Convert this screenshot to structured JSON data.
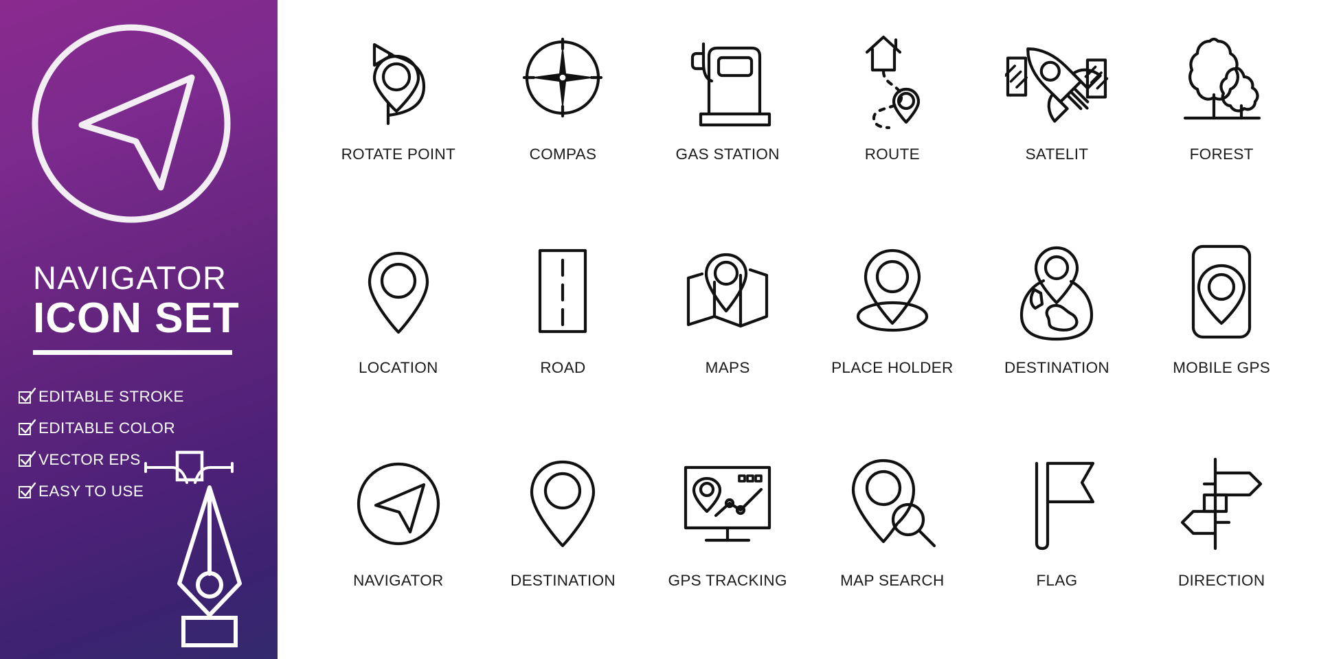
{
  "brand": {
    "logo_icon": "navigator-arrow-in-circle-icon",
    "title_line1": "NAVIGATOR",
    "title_line2": "ICON SET"
  },
  "features": [
    {
      "icon": "checkbox-checked-icon",
      "label": "EDITABLE STROKE"
    },
    {
      "icon": "checkbox-checked-icon",
      "label": "EDITABLE COLOR"
    },
    {
      "icon": "checkbox-checked-icon",
      "label": "VECTOR EPS"
    },
    {
      "icon": "checkbox-checked-icon",
      "label": "EASY TO USE"
    }
  ],
  "decorations": [
    {
      "icon": "bezier-node-handle-icon"
    },
    {
      "icon": "pen-nib-tool-icon"
    }
  ],
  "icons": [
    {
      "icon": "rotate-point-icon",
      "label": "ROTATE  POINT"
    },
    {
      "icon": "compass-icon",
      "label": "COMPAS"
    },
    {
      "icon": "gas-station-icon",
      "label": "GAS STATION"
    },
    {
      "icon": "route-icon",
      "label": "ROUTE"
    },
    {
      "icon": "satellite-icon",
      "label": "SATELIT"
    },
    {
      "icon": "forest-trees-icon",
      "label": "FOREST"
    },
    {
      "icon": "location-pin-icon",
      "label": "LOCATION"
    },
    {
      "icon": "road-icon",
      "label": "ROAD"
    },
    {
      "icon": "folded-map-pin-icon",
      "label": "MAPS"
    },
    {
      "icon": "place-holder-icon",
      "label": "PLACE HOLDER"
    },
    {
      "icon": "globe-destination-icon",
      "label": "DESTINATION"
    },
    {
      "icon": "mobile-gps-icon",
      "label": "MOBILE GPS"
    },
    {
      "icon": "navigator-arrow-icon",
      "label": "NAVIGATOR"
    },
    {
      "icon": "destination-pin-icon",
      "label": "DESTINATION"
    },
    {
      "icon": "gps-tracking-monitor-icon",
      "label": "GPS TRACKING"
    },
    {
      "icon": "map-search-icon",
      "label": "MAP SEARCH"
    },
    {
      "icon": "flag-icon",
      "label": "FLAG"
    },
    {
      "icon": "direction-signpost-icon",
      "label": "DIRECTION"
    }
  ],
  "colors": {
    "gradient_start": "#8a2a8f",
    "gradient_end": "#332a6e",
    "icon_stroke": "#111111",
    "panel_background": "#ffffff",
    "sidebar_text": "#ffffff"
  }
}
